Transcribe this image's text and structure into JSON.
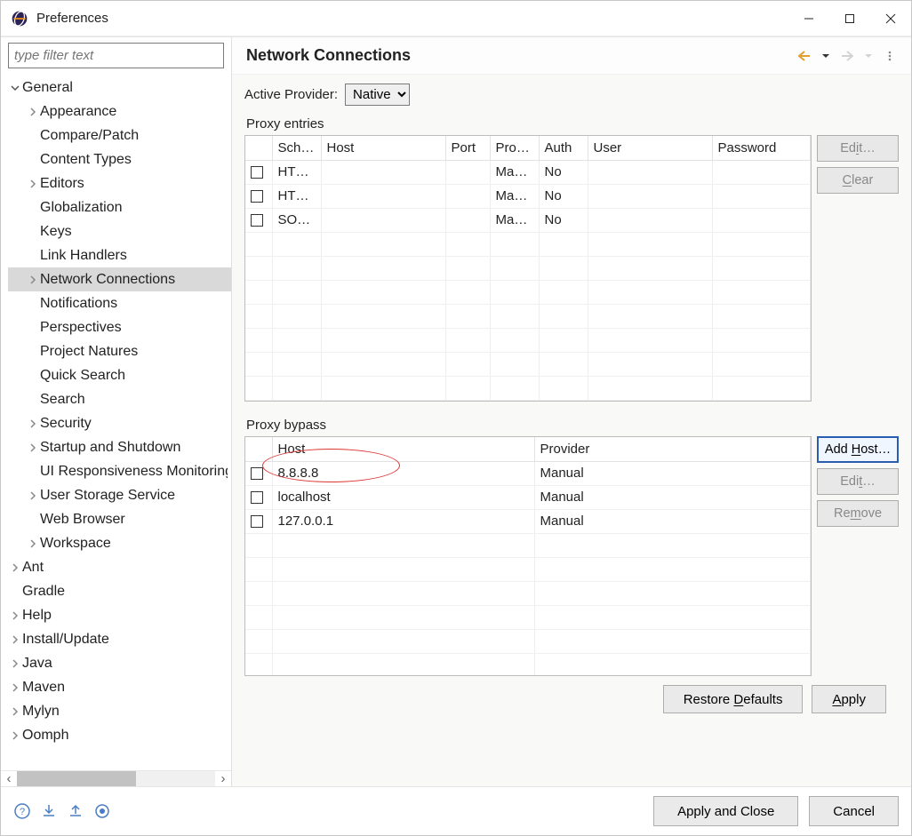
{
  "window": {
    "title": "Preferences"
  },
  "filter": {
    "placeholder": "type filter text"
  },
  "tree": {
    "general": "General",
    "items": {
      "appearance": "Appearance",
      "compare": "Compare/Patch",
      "contentTypes": "Content Types",
      "editors": "Editors",
      "globalization": "Globalization",
      "keys": "Keys",
      "linkHandlers": "Link Handlers",
      "networkConnections": "Network Connections",
      "notifications": "Notifications",
      "perspectives": "Perspectives",
      "projectNatures": "Project Natures",
      "quickSearch": "Quick Search",
      "search": "Search",
      "security": "Security",
      "startup": "Startup and Shutdown",
      "uiResp": "UI Responsiveness Monitoring",
      "userStorage": "User Storage Service",
      "webBrowser": "Web Browser",
      "workspace": "Workspace"
    },
    "top": {
      "ant": "Ant",
      "gradle": "Gradle",
      "help": "Help",
      "install": "Install/Update",
      "java": "Java",
      "maven": "Maven",
      "mylyn": "Mylyn",
      "oomph": "Oomph"
    }
  },
  "page": {
    "title": "Network Connections",
    "activeProviderLabel": "Active Provider:",
    "activeProvider": "Native",
    "proxyEntriesLabel": "Proxy entries",
    "proxyBypassLabel": "Proxy bypass",
    "headers": {
      "scheme": "Sch…",
      "host": "Host",
      "port": "Port",
      "provider": "Pro…",
      "auth": "Auth",
      "user": "User",
      "password": "Password",
      "bypassHost": "Host",
      "bypassProvider": "Provider"
    },
    "entries": [
      {
        "scheme": "HT…",
        "host": "",
        "port": "",
        "provider": "Ma…",
        "auth": "No",
        "user": "",
        "password": ""
      },
      {
        "scheme": "HT…",
        "host": "",
        "port": "",
        "provider": "Ma…",
        "auth": "No",
        "user": "",
        "password": ""
      },
      {
        "scheme": "SO…",
        "host": "",
        "port": "",
        "provider": "Ma…",
        "auth": "No",
        "user": "",
        "password": ""
      }
    ],
    "bypass": [
      {
        "host": "8.8.8.8",
        "provider": "Manual"
      },
      {
        "host": "localhost",
        "provider": "Manual"
      },
      {
        "host": "127.0.0.1",
        "provider": "Manual"
      }
    ],
    "buttons": {
      "edit": "Edit…",
      "clear": "Clear",
      "addHost": "Add Host…",
      "remove": "Remove",
      "restoreDefaults": "Restore Defaults",
      "apply": "Apply",
      "applyAndClose": "Apply and Close",
      "cancel": "Cancel"
    }
  }
}
